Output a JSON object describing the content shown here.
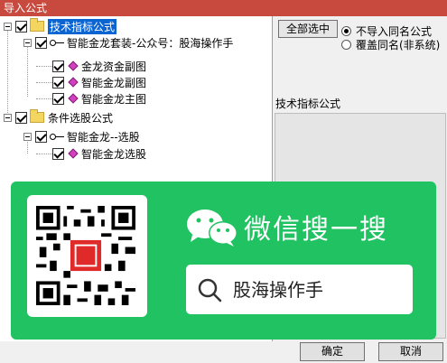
{
  "window": {
    "title": "导入公式"
  },
  "tree": {
    "items": [
      {
        "label": "技术指标公式",
        "selected": true
      },
      {
        "label": "智能金龙套装-公众号：股海操作手"
      },
      {
        "label": "金龙资金副图"
      },
      {
        "label": "智能金龙副图"
      },
      {
        "label": "智能金龙主图"
      },
      {
        "label": "条件选股公式"
      },
      {
        "label": "智能金龙--选股"
      },
      {
        "label": "智能金龙选股"
      }
    ]
  },
  "options": {
    "select_all": "全部选中",
    "radio_1": "不导入同名公式",
    "radio_2": "覆盖同名(非系统)",
    "panel_label": "技术指标公式"
  },
  "footer": {
    "ok": "确定",
    "cancel": "取消"
  },
  "banner": {
    "title": "微信搜一搜",
    "search": "股海操作手"
  },
  "colors": {
    "titlebar": "#c84a3e",
    "banner": "#20c261",
    "selection": "#0a64d2",
    "item_icon": "#d43fbf"
  }
}
